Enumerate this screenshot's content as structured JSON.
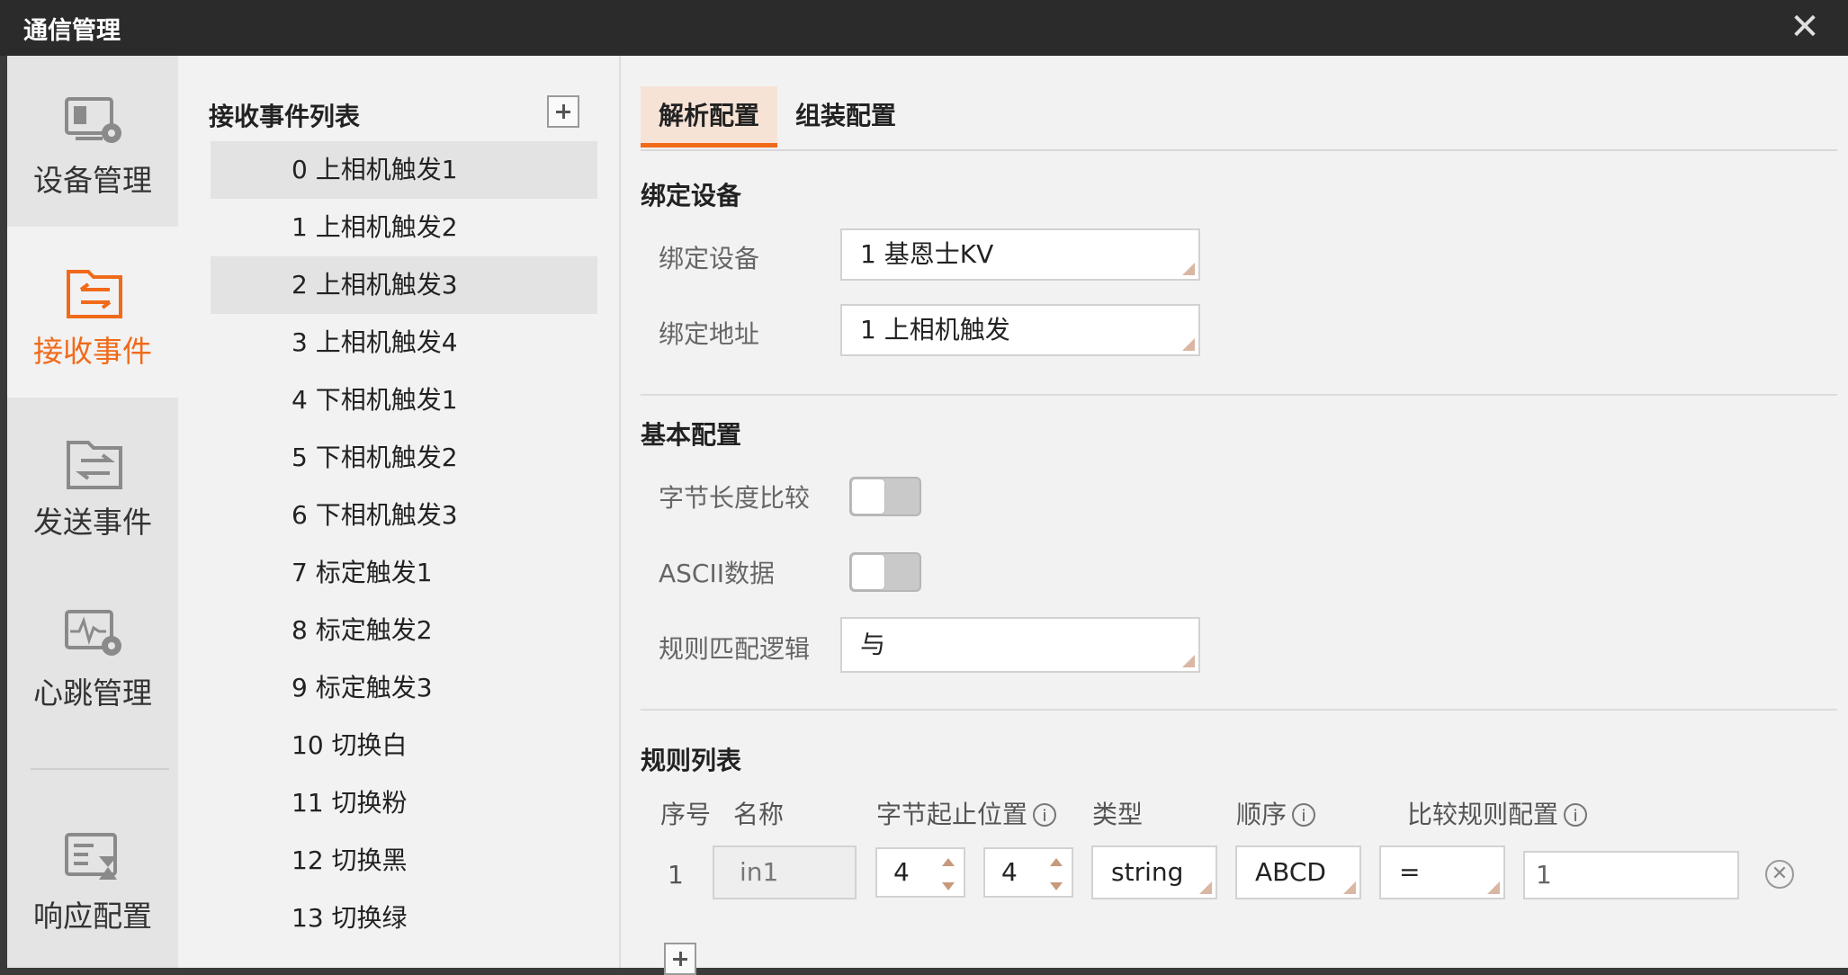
{
  "window": {
    "title": "通信管理"
  },
  "sidebar": {
    "items": [
      {
        "label": "设备管理",
        "icon": "device-gear-icon"
      },
      {
        "label": "接收事件",
        "icon": "receive-folder-icon",
        "active": true
      },
      {
        "label": "发送事件",
        "icon": "send-folder-icon"
      },
      {
        "label": "心跳管理",
        "icon": "heartbeat-gear-icon"
      },
      {
        "label": "响应配置",
        "icon": "response-config-icon"
      }
    ]
  },
  "event_list": {
    "title": "接收事件列表",
    "items": [
      "0 上相机触发1",
      "1 上相机触发2",
      "2 上相机触发3",
      "3 上相机触发4",
      "4 下相机触发1",
      "5 下相机触发2",
      "6 下相机触发3",
      "7 标定触发1",
      "8 标定触发2",
      "9 标定触发3",
      "10 切换白",
      "11 切换粉",
      "12 切换黑",
      "13 切换绿"
    ],
    "selected": "0 上相机触发1"
  },
  "tabs": [
    {
      "label": "解析配置",
      "active": true
    },
    {
      "label": "组装配置"
    }
  ],
  "bind_section": {
    "heading": "绑定设备",
    "device_label": "绑定设备",
    "device_value": "1 基恩士KV",
    "address_label": "绑定地址",
    "address_value": "1 上相机触发"
  },
  "basic_section": {
    "heading": "基本配置",
    "byte_length_label": "字节长度比较",
    "byte_length_on": false,
    "ascii_label": "ASCII数据",
    "ascii_on": false,
    "match_logic_label": "规则匹配逻辑",
    "match_logic_value": "与"
  },
  "rules_section": {
    "heading": "规则列表",
    "columns": {
      "index": "序号",
      "name": "名称",
      "byte_range": "字节起止位置",
      "type": "类型",
      "order": "顺序",
      "compare": "比较规则配置"
    },
    "info_glyph": "i",
    "rows": [
      {
        "index": "1",
        "name": "in1",
        "start": "4",
        "end": "4",
        "type": "string",
        "order": "ABCD",
        "operator": "=",
        "value": "1"
      }
    ]
  },
  "colors": {
    "accent": "#f06a1a",
    "titlebar": "#2b2b2b"
  }
}
